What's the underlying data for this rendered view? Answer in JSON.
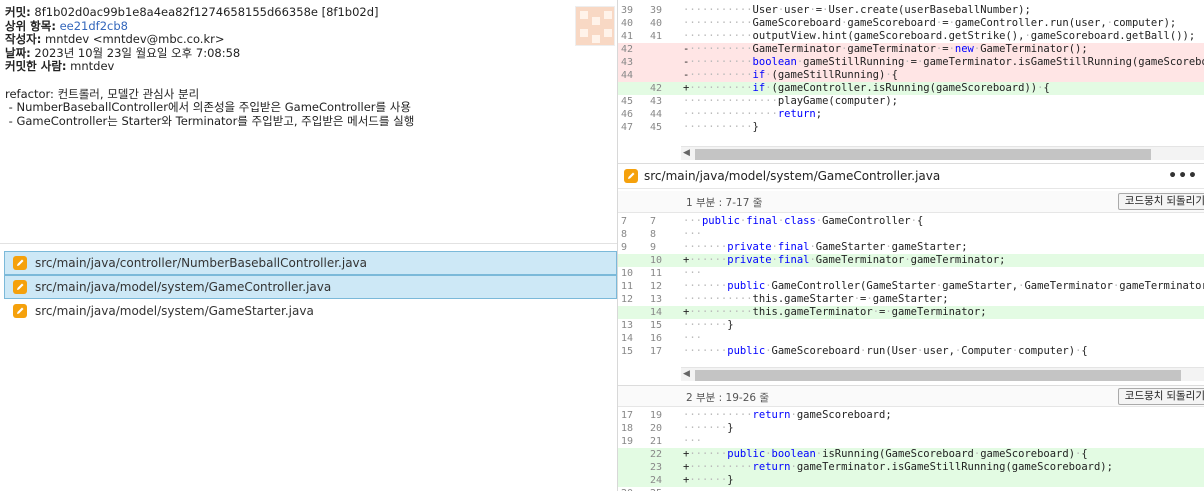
{
  "commit": {
    "hash_label": "커밋:",
    "hash_value": "8f1b02d0ac99b1e8a4ea82f1274658155d66358e [8f1b02d]",
    "parent_label": "상위 항목:",
    "parent_value": "ee21df2cb8",
    "author_label": "작성자:",
    "author_value": "mntdev <mntdev@mbc.co.kr>",
    "date_label": "날짜:",
    "date_value": "2023년 10월 23일 월요일 오후 7:08:58",
    "committer_label": "커밋한 사람:",
    "committer_value": "mntdev",
    "message_lines": [
      "refactor: 컨트롤러, 모델간 관심사 분리",
      " - NumberBaseballController에서 의존성을 주입받은 GameController를 사용",
      " - GameController는 Starter와 Terminator를 주입받고, 주입받은 메서드를 실행"
    ]
  },
  "files": [
    {
      "path": "src/main/java/controller/NumberBaseballController.java",
      "selected": true
    },
    {
      "path": "src/main/java/model/system/GameController.java",
      "selected": true
    },
    {
      "path": "src/main/java/model/system/GameStarter.java",
      "selected": false
    }
  ],
  "diff_top": {
    "lines": [
      {
        "o": "39",
        "n": "39",
        "t": "ctx",
        "code": "···········User·user·=·User.create(userBaseballNumber);"
      },
      {
        "o": "40",
        "n": "40",
        "t": "ctx",
        "code": "···········GameScoreboard·gameScoreboard·=·gameController.run(user,·computer);"
      },
      {
        "o": "41",
        "n": "41",
        "t": "ctx",
        "code": "···········outputView.hint(gameScoreboard.getStrike(),·gameScoreboard.getBall());"
      },
      {
        "o": "42",
        "n": "",
        "t": "del",
        "code": "-··········GameTerminator·gameTerminator·=·new·GameTerminator();"
      },
      {
        "o": "43",
        "n": "",
        "t": "del",
        "code": "-··········boolean·gameStillRunning·=·gameTerminator.isGameStillRunning(gameScoreboard);"
      },
      {
        "o": "44",
        "n": "",
        "t": "del",
        "code": "-··········if·(gameStillRunning)·{"
      },
      {
        "o": "",
        "n": "42",
        "t": "add",
        "code": "+··········if·(gameController.isRunning(gameScoreboard))·{"
      },
      {
        "o": "45",
        "n": "43",
        "t": "ctx",
        "code": "···············playGame(computer);"
      },
      {
        "o": "46",
        "n": "44",
        "t": "ctx",
        "code": "···············return;"
      },
      {
        "o": "47",
        "n": "45",
        "t": "ctx",
        "code": "···········}"
      }
    ]
  },
  "file_header": {
    "path": "src/main/java/model/system/GameController.java",
    "more": "•••"
  },
  "hunk1": {
    "label": "1 부분 : 7-17 줄",
    "revert": "코드뭉치 되돌리기",
    "lines": [
      {
        "o": "7",
        "n": "7",
        "t": "ctx",
        "code": "···public·final·class·GameController·{"
      },
      {
        "o": "8",
        "n": "8",
        "t": "ctx",
        "code": "···"
      },
      {
        "o": "9",
        "n": "9",
        "t": "ctx",
        "code": "·······private·final·GameStarter·gameStarter;"
      },
      {
        "o": "",
        "n": "10",
        "t": "add",
        "code": "+······private·final·GameTerminator·gameTerminator;"
      },
      {
        "o": "10",
        "n": "11",
        "t": "ctx",
        "code": "···"
      },
      {
        "o": "11",
        "n": "12",
        "t": "ctx",
        "code": "·······public·GameController(GameStarter·gameStarter,·GameTerminator·gameTerminator)·{"
      },
      {
        "o": "12",
        "n": "13",
        "t": "ctx",
        "code": "···········this.gameStarter·=·gameStarter;"
      },
      {
        "o": "",
        "n": "14",
        "t": "add",
        "code": "+··········this.gameTerminator·=·gameTerminator;"
      },
      {
        "o": "13",
        "n": "15",
        "t": "ctx",
        "code": "·······}"
      },
      {
        "o": "14",
        "n": "16",
        "t": "ctx",
        "code": "···"
      },
      {
        "o": "15",
        "n": "17",
        "t": "ctx",
        "code": "·······public·GameScoreboard·run(User·user,·Computer·computer)·{"
      }
    ]
  },
  "hunk2": {
    "label": "2 부분 : 19-26 줄",
    "revert": "코드뭉치 되돌리기",
    "lines": [
      {
        "o": "17",
        "n": "19",
        "t": "ctx",
        "code": "···········return·gameScoreboard;"
      },
      {
        "o": "18",
        "n": "20",
        "t": "ctx",
        "code": "·······}"
      },
      {
        "o": "19",
        "n": "21",
        "t": "ctx",
        "code": "···"
      },
      {
        "o": "",
        "n": "22",
        "t": "add",
        "code": "+······public·boolean·isRunning(GameScoreboard·gameScoreboard)·{"
      },
      {
        "o": "",
        "n": "23",
        "t": "add",
        "code": "+··········return·gameTerminator.isGameStillRunning(gameScoreboard);"
      },
      {
        "o": "",
        "n": "24",
        "t": "add",
        "code": "+······}"
      },
      {
        "o": "20",
        "n": "25",
        "t": "ctx",
        "code": ""
      }
    ]
  },
  "colors": {
    "accent_pencil": "#f5a10c",
    "add_bg": "#e3fbe3",
    "del_bg": "#ffe5e5",
    "selection": "#cde8f6"
  }
}
